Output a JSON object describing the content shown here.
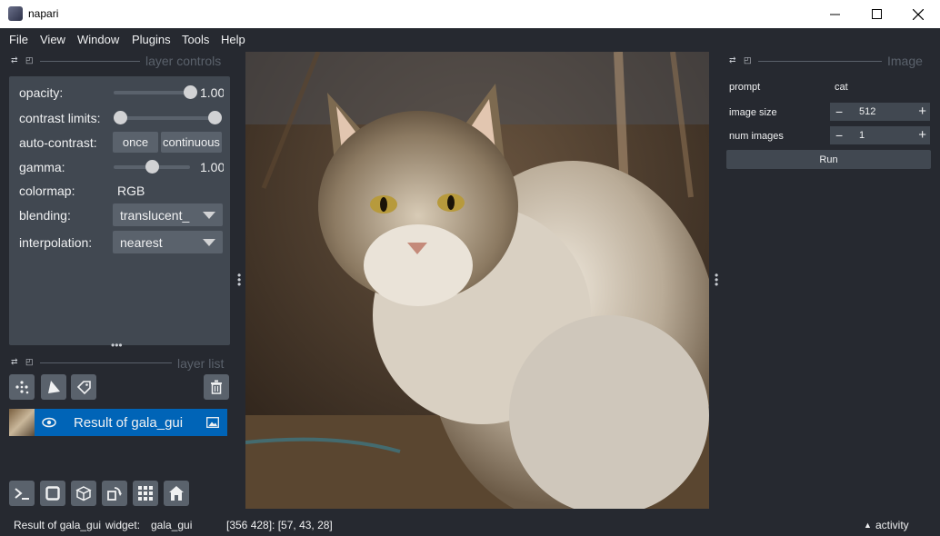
{
  "window": {
    "title": "napari",
    "minimize_icon": "minimize-icon",
    "maximize_icon": "maximize-icon",
    "close_icon": "close-icon"
  },
  "menu": [
    "File",
    "View",
    "Window",
    "Plugins",
    "Tools",
    "Help"
  ],
  "layer_controls": {
    "title": "layer controls",
    "opacity_label": "opacity:",
    "opacity_value": "1.00",
    "opacity_level": 1.0,
    "contrast_label": "contrast limits:",
    "contrast_range": [
      0.0,
      1.0
    ],
    "auto_contrast_label": "auto-contrast:",
    "once_button": "once",
    "continuous_button": "continuous",
    "gamma_label": "gamma:",
    "gamma_value": "1.00",
    "gamma_level": 0.5,
    "colormap_label": "colormap:",
    "colormap_value": "RGB",
    "blending_label": "blending:",
    "blending_value": "translucent_",
    "interpolation_label": "interpolation:",
    "interpolation_value": "nearest"
  },
  "layer_list": {
    "title": "layer list",
    "tools": [
      "points-icon",
      "shapes-icon",
      "labels-icon"
    ],
    "delete_icon": "trash-icon",
    "layers": [
      {
        "name": "Result of gala_gui",
        "type_icon": "image-icon",
        "visibility_icon": "eye-icon"
      }
    ]
  },
  "bottom_tools": [
    "console-icon",
    "square-icon",
    "3d-cube-icon",
    "rotate-icon",
    "grid-icon",
    "home-icon"
  ],
  "right_panel": {
    "title": "Image",
    "prompt_label": "prompt",
    "prompt_value": "cat",
    "image_size_label": "image size",
    "image_size_value": "512",
    "num_images_label": "num images",
    "num_images_value": "1",
    "minus": "−",
    "plus": "+",
    "run_button": "Run"
  },
  "status": {
    "layer": "Result of gala_gui",
    "widget_label": "widget:",
    "widget_value": "gala_gui",
    "coords": "[356 428]: [57, 43, 28]",
    "activity": "activity",
    "activity_icon": "triangle-up-icon"
  },
  "colors": {
    "background": "#262930",
    "panel": "#414851",
    "control": "#5a626c",
    "selection": "#0064b7",
    "text": "#f0f1f2"
  }
}
